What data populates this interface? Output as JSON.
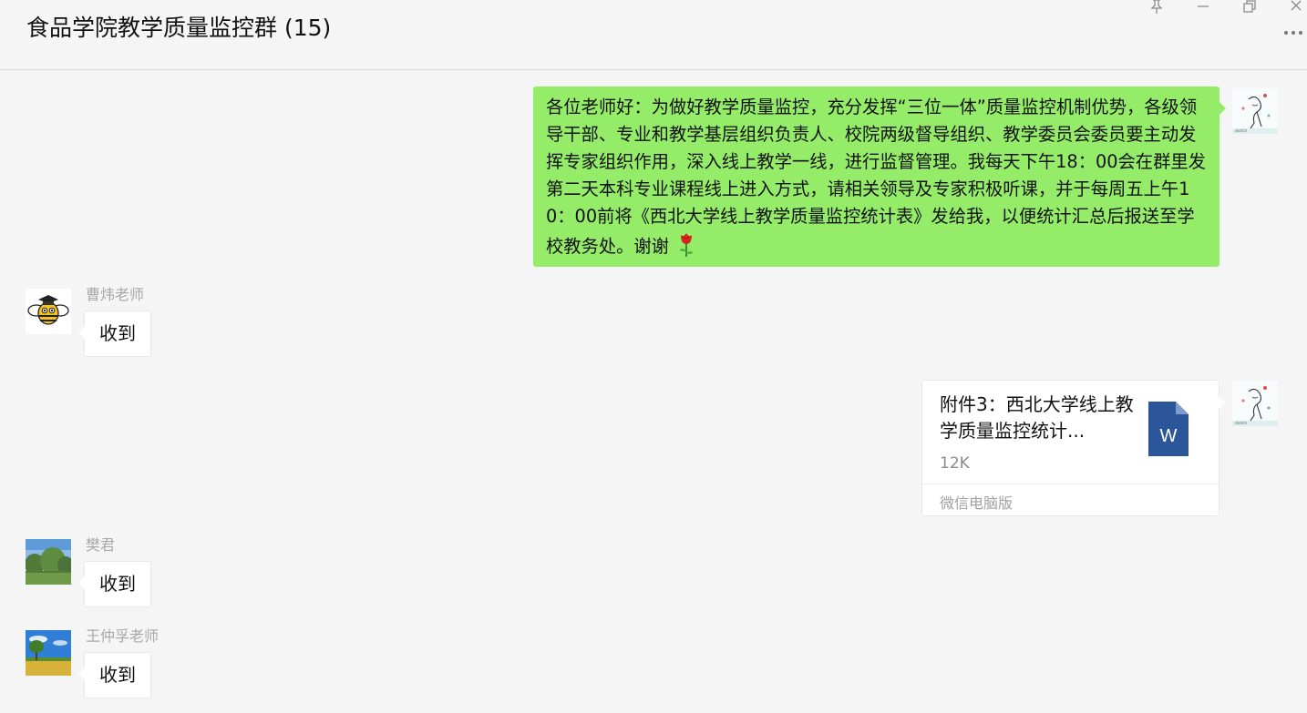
{
  "header": {
    "title": "食品学院教学质量监控群 (15)",
    "window_controls": {
      "pin": "⊥",
      "minimize": "—",
      "restore": "❐",
      "close": "✕"
    },
    "more_icon": "···"
  },
  "messages": [
    {
      "type": "text",
      "direction": "outgoing",
      "avatar_icon": "user-avatar-sketch-icon",
      "text": "各位老师好：为做好教学质量监控，充分发挥“三位一体”质量监控机制优势，各级领导干部、专业和教学基层组织负责人、校院两级督导组织、教学委员会委员要主动发挥专家组织作用，深入线上教学一线，进行监督管理。我每天下午18：00会在群里发第二天本科专业课程线上进入方式，请相关领导及专家积极听课，并于每周五上午10：00前将《西北大学线上教学质量监控统计表》发给我，以便统计汇总后报送至学校教务处。谢谢",
      "emoji": "rose-icon"
    },
    {
      "type": "text",
      "direction": "incoming",
      "sender": "曹炜老师",
      "avatar_icon": "bee-avatar-icon",
      "text": "收到"
    },
    {
      "type": "file",
      "direction": "outgoing",
      "avatar_icon": "user-avatar-sketch-icon",
      "file_name": "附件3：西北大学线上教学质量监控统计...",
      "file_size": "12K",
      "file_icon_letter": "W",
      "source": "微信电脑版"
    },
    {
      "type": "text",
      "direction": "incoming",
      "sender": "樊君",
      "avatar_icon": "trees-avatar-icon",
      "text": "收到"
    },
    {
      "type": "text",
      "direction": "incoming",
      "sender": "王仲孚老师",
      "avatar_icon": "field-tree-avatar-icon",
      "text": "收到"
    }
  ],
  "colors": {
    "background": "#f5f5f5",
    "outgoing_bubble": "#95ec69",
    "incoming_bubble": "#ffffff",
    "word_icon": "#2b579a",
    "sender_name": "#a8a8a8"
  }
}
